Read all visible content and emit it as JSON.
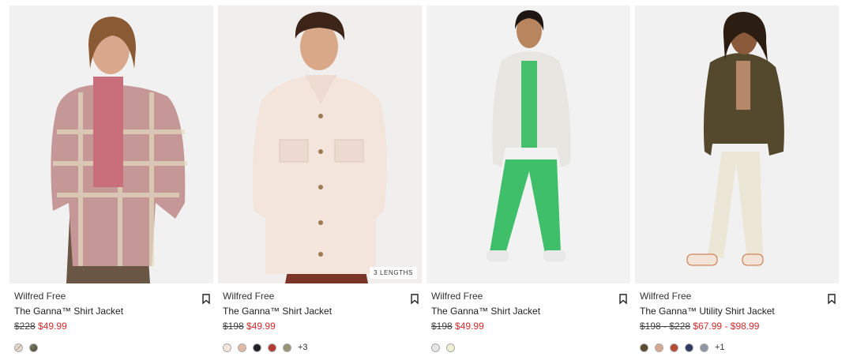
{
  "products": [
    {
      "brand": "Wilfred Free",
      "name": "The Ganna™ Shirt Jacket",
      "original_price": "$228",
      "sale_price": "$49.99",
      "badge": "",
      "swatches": [
        "#c9b3a6",
        "#4c4d3b"
      ],
      "more": "",
      "image": "model-red-plaid-shirt-jacket"
    },
    {
      "brand": "Wilfred Free",
      "name": "The Ganna™ Shirt Jacket",
      "original_price": "$198",
      "sale_price": "$49.99",
      "badge": "3 LENGTHS",
      "swatches": [
        "#f3e6dd",
        "#e2b9a4",
        "#222326",
        "#b23a32",
        "#9a9277"
      ],
      "more": "+3",
      "image": "model-cream-shirt-jacket"
    },
    {
      "brand": "Wilfred Free",
      "name": "The Ganna™ Shirt Jacket",
      "original_price": "$198",
      "sale_price": "$49.99",
      "badge": "",
      "swatches": [
        "#e6e6e3",
        "#f1efd2"
      ],
      "more": "",
      "image": "model-white-shirt-jacket-green-pants"
    },
    {
      "brand": "Wilfred Free",
      "name": "The Ganna™ Utility Shirt Jacket",
      "original_price": "$198 - $228",
      "sale_price": "$67.99 - $98.99",
      "badge": "",
      "swatches": [
        "#5a4a30",
        "#d9a890",
        "#b44c36",
        "#2f3a64",
        "#8d96a4"
      ],
      "more": "+1",
      "image": "model-olive-utility-shirt-jacket"
    }
  ],
  "icons": {
    "bookmark": "bookmark-icon"
  }
}
